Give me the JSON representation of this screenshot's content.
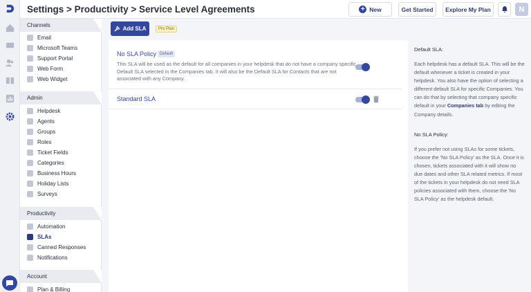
{
  "header": {
    "title": "Settings > Productivity > Service Level Agreements",
    "new_label": "New",
    "get_started_label": "Get Started",
    "explore_label": "Explore My Plan",
    "avatar_initial": "N"
  },
  "nav": {
    "sections": [
      {
        "title": "Channels",
        "items": [
          "Email",
          "Microsoft Teams",
          "Support Portal",
          "Web Form",
          "Web Widget"
        ]
      },
      {
        "title": "Admin",
        "items": [
          "Helpdesk",
          "Agents",
          "Groups",
          "Roles",
          "Ticket Fields",
          "Categories",
          "Business Hours",
          "Holiday Lists",
          "Surveys"
        ]
      },
      {
        "title": "Productivity",
        "items": [
          "Automation",
          "SLAs",
          "Canned Responses",
          "Notifications"
        ]
      },
      {
        "title": "Account",
        "items": [
          "Plan & Billing"
        ]
      }
    ],
    "active_item": "SLAs"
  },
  "toolbar": {
    "add_sla_label": "Add SLA",
    "pro_badge": "Pro Plan"
  },
  "slas": [
    {
      "name": "No SLA Policy",
      "badge": "Default",
      "description": "This SLA will be used as the default for all companies in your helpdesk that do not have a company specific Default SLA selected in the Companies tab. It will also be the Default SLA for Contacts that are not associated with any Company.",
      "enabled": true
    },
    {
      "name": "Standard SLA",
      "enabled": true
    }
  ],
  "help": {
    "default_title": "Default SLA:",
    "default_text_before": "Each helpdesk has a default SLA. This will be the default whenever a ticket is created in your helpdesk. You also have the option of selecting a different default SLA for specific Companies. You can do that by selecting that company specific default in your ",
    "default_link": "Companies tab",
    "default_text_after": " by editing the Company details.",
    "nosla_title": "No SLA Policy:",
    "nosla_text": "If you prefer not using SLAs for some tickets, choose the 'No SLA Policy' as the SLA. Once it is chosen, tickets associated with it will show no due dates and other SLA related metrics. If most of the tickets in your helpdesk do not need SLA policies associated with them, choose the 'No SLA Policy' as the helpdesk default."
  },
  "colors": {
    "primary": "#34479e",
    "link": "#2d3b78",
    "badge_pro_bg": "#fdf3c7"
  }
}
